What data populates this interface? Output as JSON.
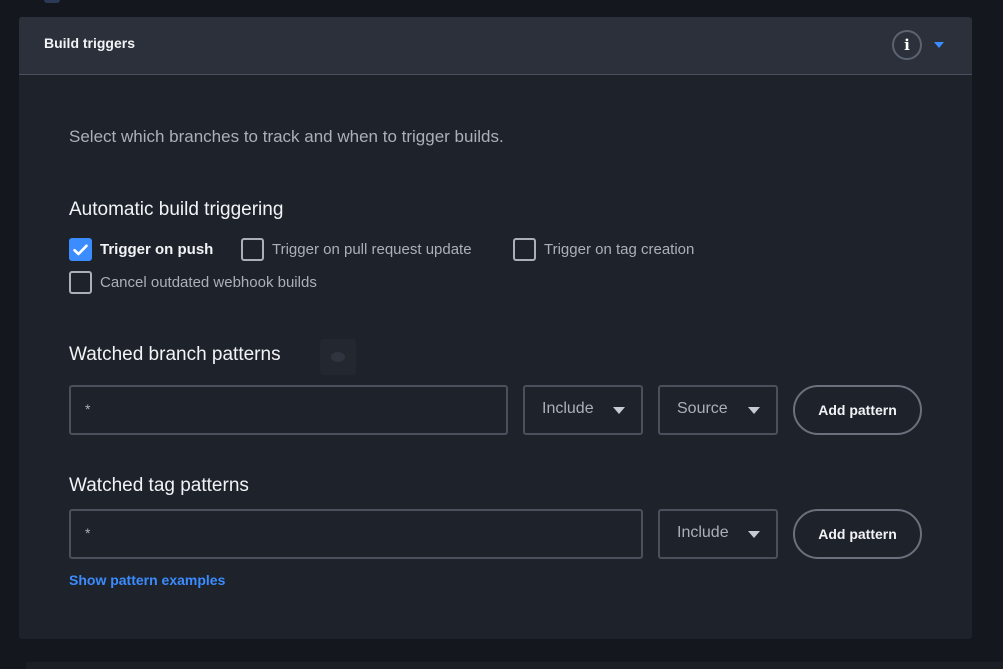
{
  "panel": {
    "title": "Build triggers",
    "info_icon": "info-icon",
    "collapse_icon": "caret-down-icon",
    "accent": "#3b8cff"
  },
  "description": "Select which branches to track and when to trigger builds.",
  "automatic": {
    "title": "Automatic build triggering",
    "options": [
      {
        "label": "Trigger on push",
        "checked": true
      },
      {
        "label": "Trigger on pull request update",
        "checked": false
      },
      {
        "label": "Trigger on tag creation",
        "checked": false
      },
      {
        "label": "Cancel outdated webhook builds",
        "checked": false
      }
    ]
  },
  "branch_patterns": {
    "title": "Watched branch patterns",
    "pattern_value": "*",
    "include_select": "Include",
    "source_select": "Source",
    "add_button": "Add pattern"
  },
  "tag_patterns": {
    "title": "Watched tag patterns",
    "pattern_value": "*",
    "include_select": "Include",
    "add_button": "Add pattern"
  },
  "examples_link": "Show pattern examples"
}
